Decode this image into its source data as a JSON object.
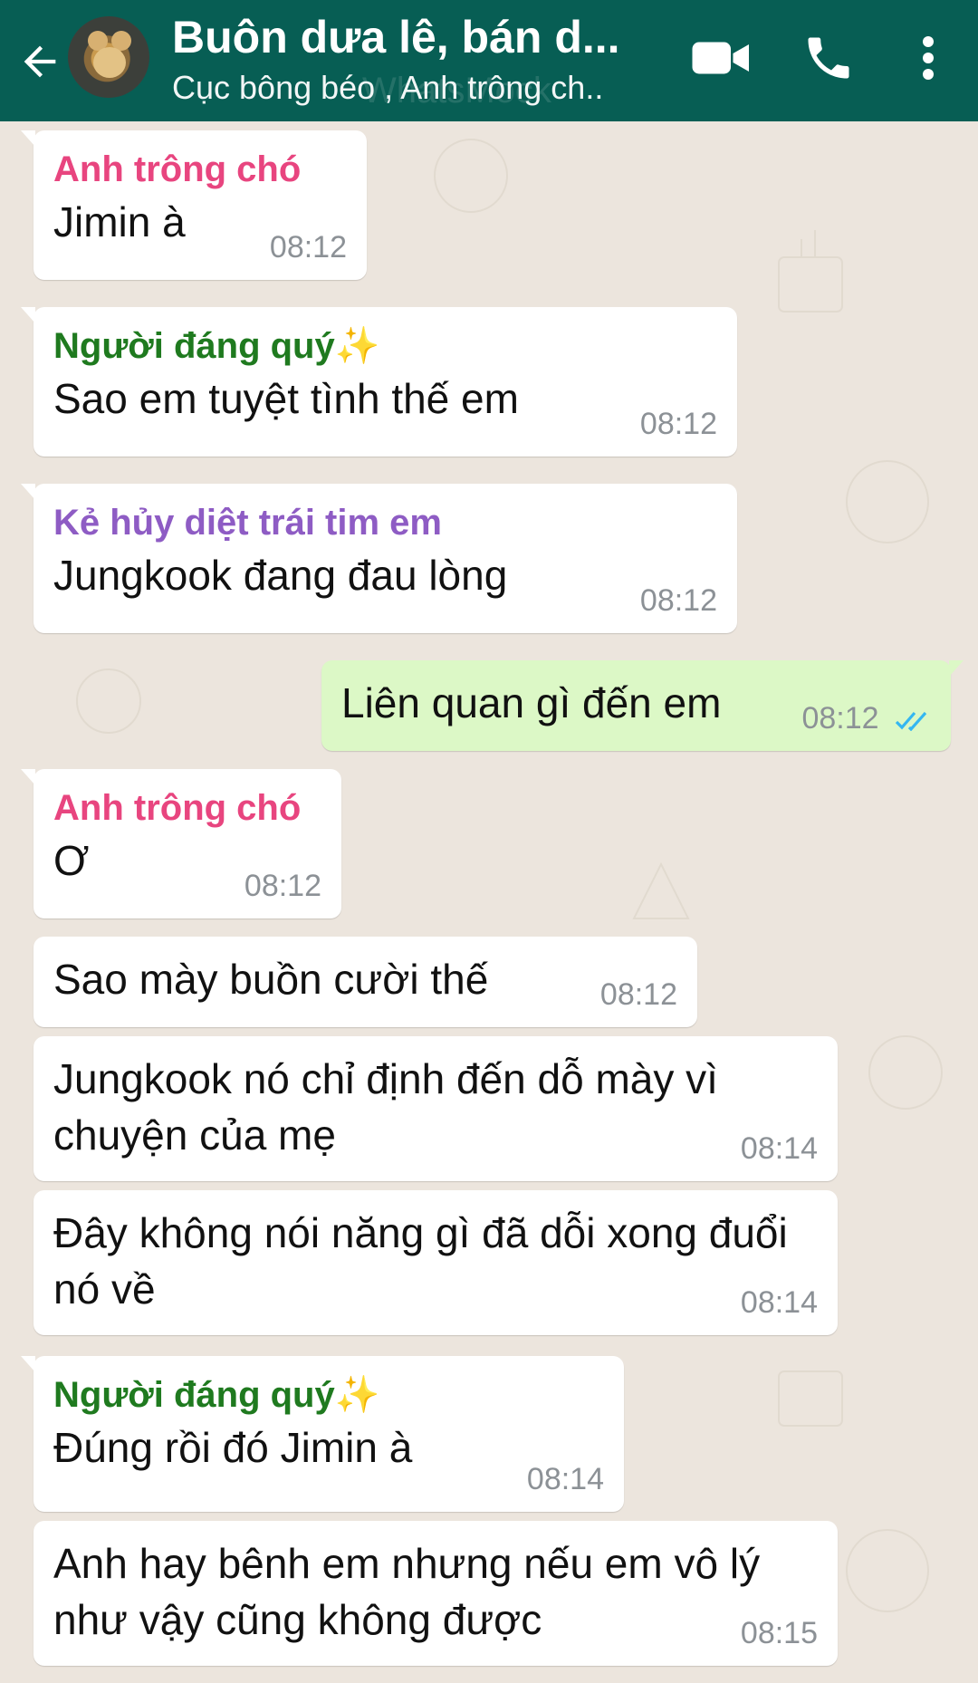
{
  "header": {
    "title": "Buôn dưa lê, bán d...",
    "subtitle": "Cục bông béo , Anh trông ch..",
    "watermark": "WhatsMock"
  },
  "colors": {
    "header_bg": "#075e54",
    "chat_bg": "#ece5dd",
    "incoming_bubble": "#ffffff",
    "outgoing_bubble": "#dcf8c6",
    "sender_pink": "#e8457f",
    "sender_green": "#1f7a1f",
    "sender_purple": "#8e5cc4",
    "read_ticks": "#34b7f1"
  },
  "icons": [
    "back-arrow-icon",
    "group-avatar",
    "video-call-icon",
    "phone-call-icon",
    "more-options-icon",
    "double-check-icon"
  ],
  "messages": [
    {
      "sender": "Anh trông chó",
      "text": "Jimin à",
      "time": "08:12"
    },
    {
      "sender": "Người đáng quý✨",
      "text": "Sao em tuyệt tình thế em",
      "time": "08:12"
    },
    {
      "sender": "Kẻ hủy diệt trái tim em",
      "text": "Jungkook đang đau lòng",
      "time": "08:12"
    },
    {
      "sender": "",
      "text": "Liên quan gì đến em",
      "time": "08:12",
      "outgoing": true,
      "status": "read"
    },
    {
      "sender": "Anh trông chó",
      "text": "Ơ",
      "time": "08:12"
    },
    {
      "sender": "",
      "text": "Sao mày buồn cười thế",
      "time": "08:12"
    },
    {
      "sender": "",
      "text": "Jungkook nó chỉ định đến dỗ mày vì chuyện của mẹ",
      "time": "08:14"
    },
    {
      "sender": "",
      "text": "Đây không nói năng gì đã dỗi xong đuổi nó về",
      "time": "08:14"
    },
    {
      "sender": "Người đáng quý✨",
      "text": "Đúng rồi đó Jimin à",
      "time": "08:14"
    },
    {
      "sender": "",
      "text": "Anh hay bênh em nhưng nếu em vô lý như vậy cũng không được",
      "time": "08:15"
    }
  ]
}
